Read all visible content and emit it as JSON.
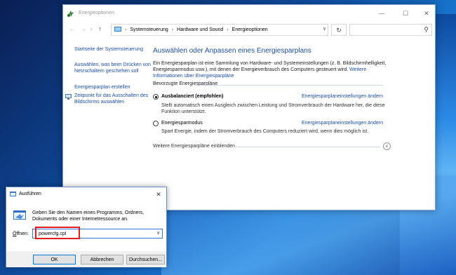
{
  "control_panel": {
    "window_title": "Energieoptionen",
    "breadcrumb": [
      "Systemsteuerung",
      "Hardware und Sound",
      "Energieoptionen"
    ],
    "sidebar": {
      "home_link": "Startseite der Systemsteuerung",
      "links": [
        "Auswählen, was beim Drücken von Netzschaltern geschehen soll",
        "Energiesparplan erstellen",
        "Zeitpunkt für das Ausschalten des Bildschirms auswählen"
      ]
    },
    "main": {
      "title": "Auswählen oder Anpassen eines Energiesparplans",
      "description": "Ein Energiesparplan ist eine Sammlung von Hardware- und Systemeinstellungen (z. B. Bildschirmhelligkeit, Energiesparmodus usw.), mit denen der Energieverbrauch des Computers gesteuert wird.",
      "more_info_link": "Weitere Informationen über Energiesparpläne",
      "section_label": "Bevorzugte Energiesparpläne",
      "plans": [
        {
          "name": "Ausbalanciert (empfohlen)",
          "selected": true,
          "description": "Stellt automatisch einen Ausgleich zwischen Leistung und Stromverbrauch der Hardware her, die diese Funktion unterstützt.",
          "settings_link": "Energiesparplaneinstellungen ändern"
        },
        {
          "name": "Energiesparmodus",
          "selected": false,
          "description": "Spart Energie, indem der Stromverbrauch des Computers reduziert wird, wenn dies möglich ist.",
          "settings_link": "Energiesparplaneinstellungen ändern"
        }
      ],
      "more_plans_label": "Weitere Energiesparpläne einblenden"
    }
  },
  "run_dialog": {
    "title": "Ausführen",
    "description": "Geben Sie den Namen eines Programms, Ordners, Dokuments oder einer Internetressource an.",
    "open_label_prefix": "",
    "open_label_underlined": "Ö",
    "open_label_suffix": "ffnen:",
    "input_value": "powercfg.cpl",
    "ok_label": "OK",
    "cancel_label": "Abbrechen",
    "browse_label": "Durchsuchen...",
    "highlight_color": "#e21b1b"
  },
  "colors": {
    "link": "#1a4ea8",
    "title": "#1e4f9c",
    "accent": "#0078d7"
  },
  "icons": {
    "window_icon": "power-options-icon",
    "back": "arrow-left-icon",
    "forward": "arrow-right-icon",
    "recent": "chevron-down-icon",
    "up": "arrow-up-icon",
    "refresh": "refresh-icon",
    "search": "search-icon",
    "screen": "monitor-clock-icon",
    "run": "run-icon"
  }
}
